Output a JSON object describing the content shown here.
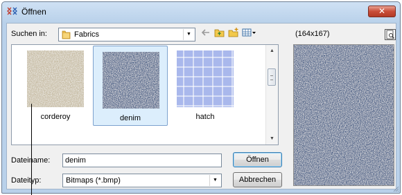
{
  "window": {
    "title": "Öffnen",
    "close_label": "✕"
  },
  "look_in": {
    "label": "Suchen in:",
    "value": "Fabrics"
  },
  "files": [
    {
      "name": "corderoy",
      "selected": false,
      "color": "#c4b99f"
    },
    {
      "name": "denim",
      "selected": true,
      "color": "#4a5f86"
    },
    {
      "name": "hatch",
      "selected": false,
      "color": "#a9b8ec"
    }
  ],
  "filename": {
    "label": "Dateiname:",
    "value": "denim"
  },
  "filetype": {
    "label": "Dateityp:",
    "value": "Bitmaps (*.bmp)"
  },
  "buttons": {
    "open": "Öffnen",
    "cancel": "Abbrechen"
  },
  "preview": {
    "size_text": "(164x167)"
  },
  "toolbar_icons": [
    "back-arrow-icon",
    "up-folder-icon",
    "new-folder-icon",
    "view-menu-icon"
  ],
  "colors": {
    "selection_bg": "#dceefc",
    "selection_border": "#7da2ce",
    "title_bg": "#b9d1ea",
    "close_red": "#c94d38"
  }
}
